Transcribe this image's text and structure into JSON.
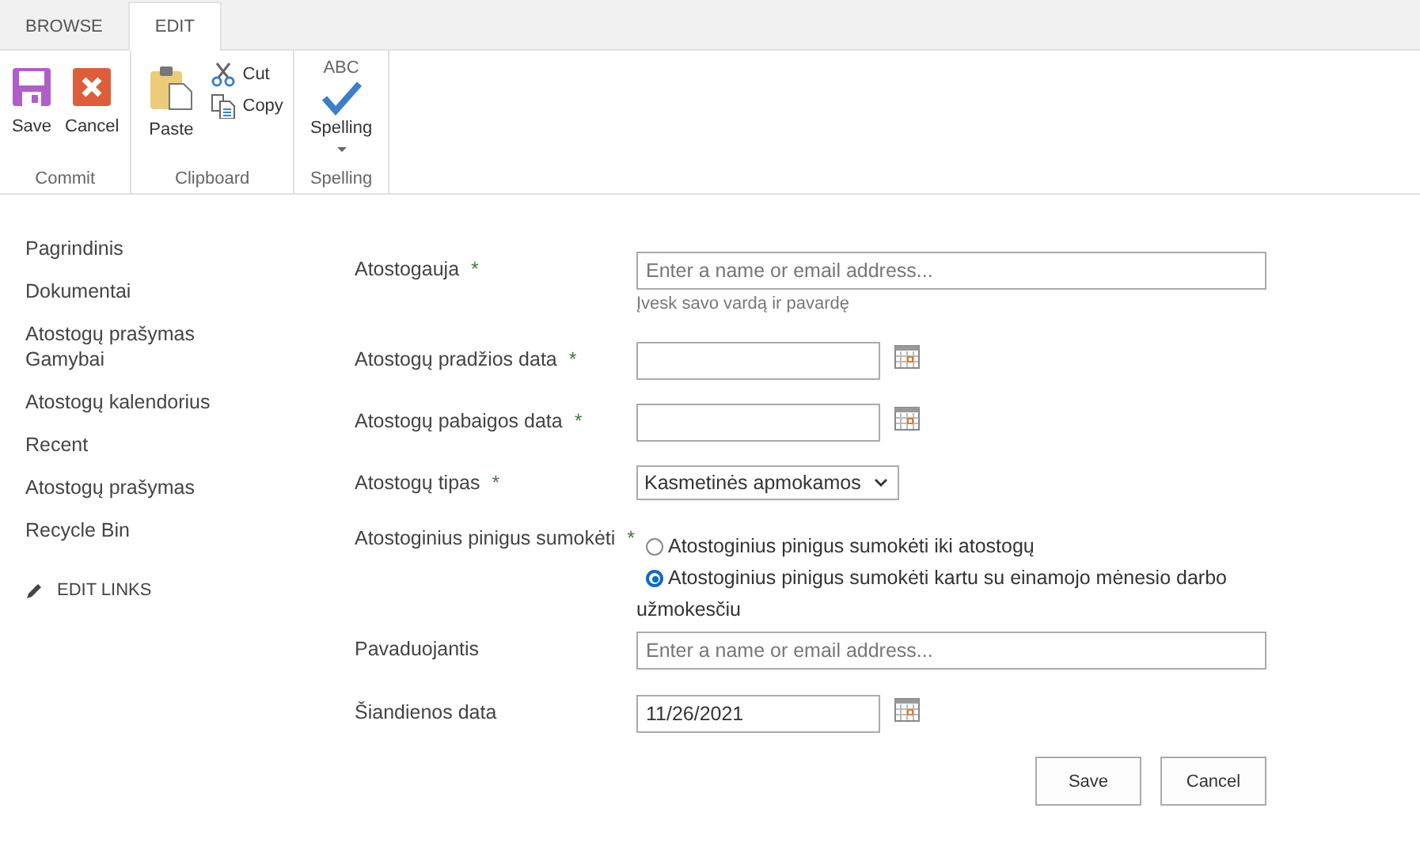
{
  "tabs": [
    {
      "label": "BROWSE",
      "selected": false
    },
    {
      "label": "EDIT",
      "selected": true
    }
  ],
  "ribbon": [
    {
      "label": "Commit",
      "buttons": [
        {
          "kind": "save",
          "label": "Save"
        },
        {
          "kind": "cancel",
          "label": "Cancel"
        }
      ]
    },
    {
      "label": "Clipboard",
      "buttons": [
        {
          "kind": "paste",
          "label": "Paste"
        },
        {
          "kind": "cut",
          "label": "Cut"
        },
        {
          "kind": "copy",
          "label": "Copy"
        }
      ]
    },
    {
      "label": "Spelling",
      "buttons": [
        {
          "kind": "spelling",
          "label": "Spelling",
          "icon_text": "ABC"
        }
      ]
    }
  ],
  "sidebar": {
    "items": [
      "Pagrindinis",
      "Dokumentai",
      "Atostogų prašymas Gamybai",
      "Atostogų kalendorius",
      "Recent",
      "Atostogų prašymas",
      "Recycle Bin"
    ],
    "edit_links": "EDIT LINKS"
  },
  "form": {
    "fields": [
      {
        "kind": "people",
        "label": "Atostogauja",
        "required_mark": "*",
        "placeholder": "Enter a name or email address...",
        "hint": "Įvesk savo vardą ir pavardę"
      },
      {
        "kind": "date",
        "label": "Atostogų pradžios data",
        "required_mark": "*"
      },
      {
        "kind": "date",
        "label": "Atostogų pabaigos data",
        "required_mark": "*"
      },
      {
        "kind": "select",
        "label": "Atostogų tipas",
        "required_mark": "*",
        "value": "Kasmetinės apmokamos"
      },
      {
        "kind": "radio",
        "label": "Atostoginius pinigus sumokėti",
        "required_mark": "*",
        "options": [
          {
            "label": "Atostoginius pinigus sumokėti iki atostogų",
            "selected": false
          },
          {
            "label": "Atostoginius pinigus sumokėti kartu su einamojo mėnesio darbo užmokesčiu",
            "selected": true
          }
        ]
      },
      {
        "kind": "people",
        "label": "Pavaduojantis",
        "placeholder": "Enter a name or email address..."
      },
      {
        "kind": "date",
        "label": "Šiandienos data",
        "value": "11/26/2021"
      }
    ],
    "buttons": [
      "Save",
      "Cancel"
    ]
  }
}
